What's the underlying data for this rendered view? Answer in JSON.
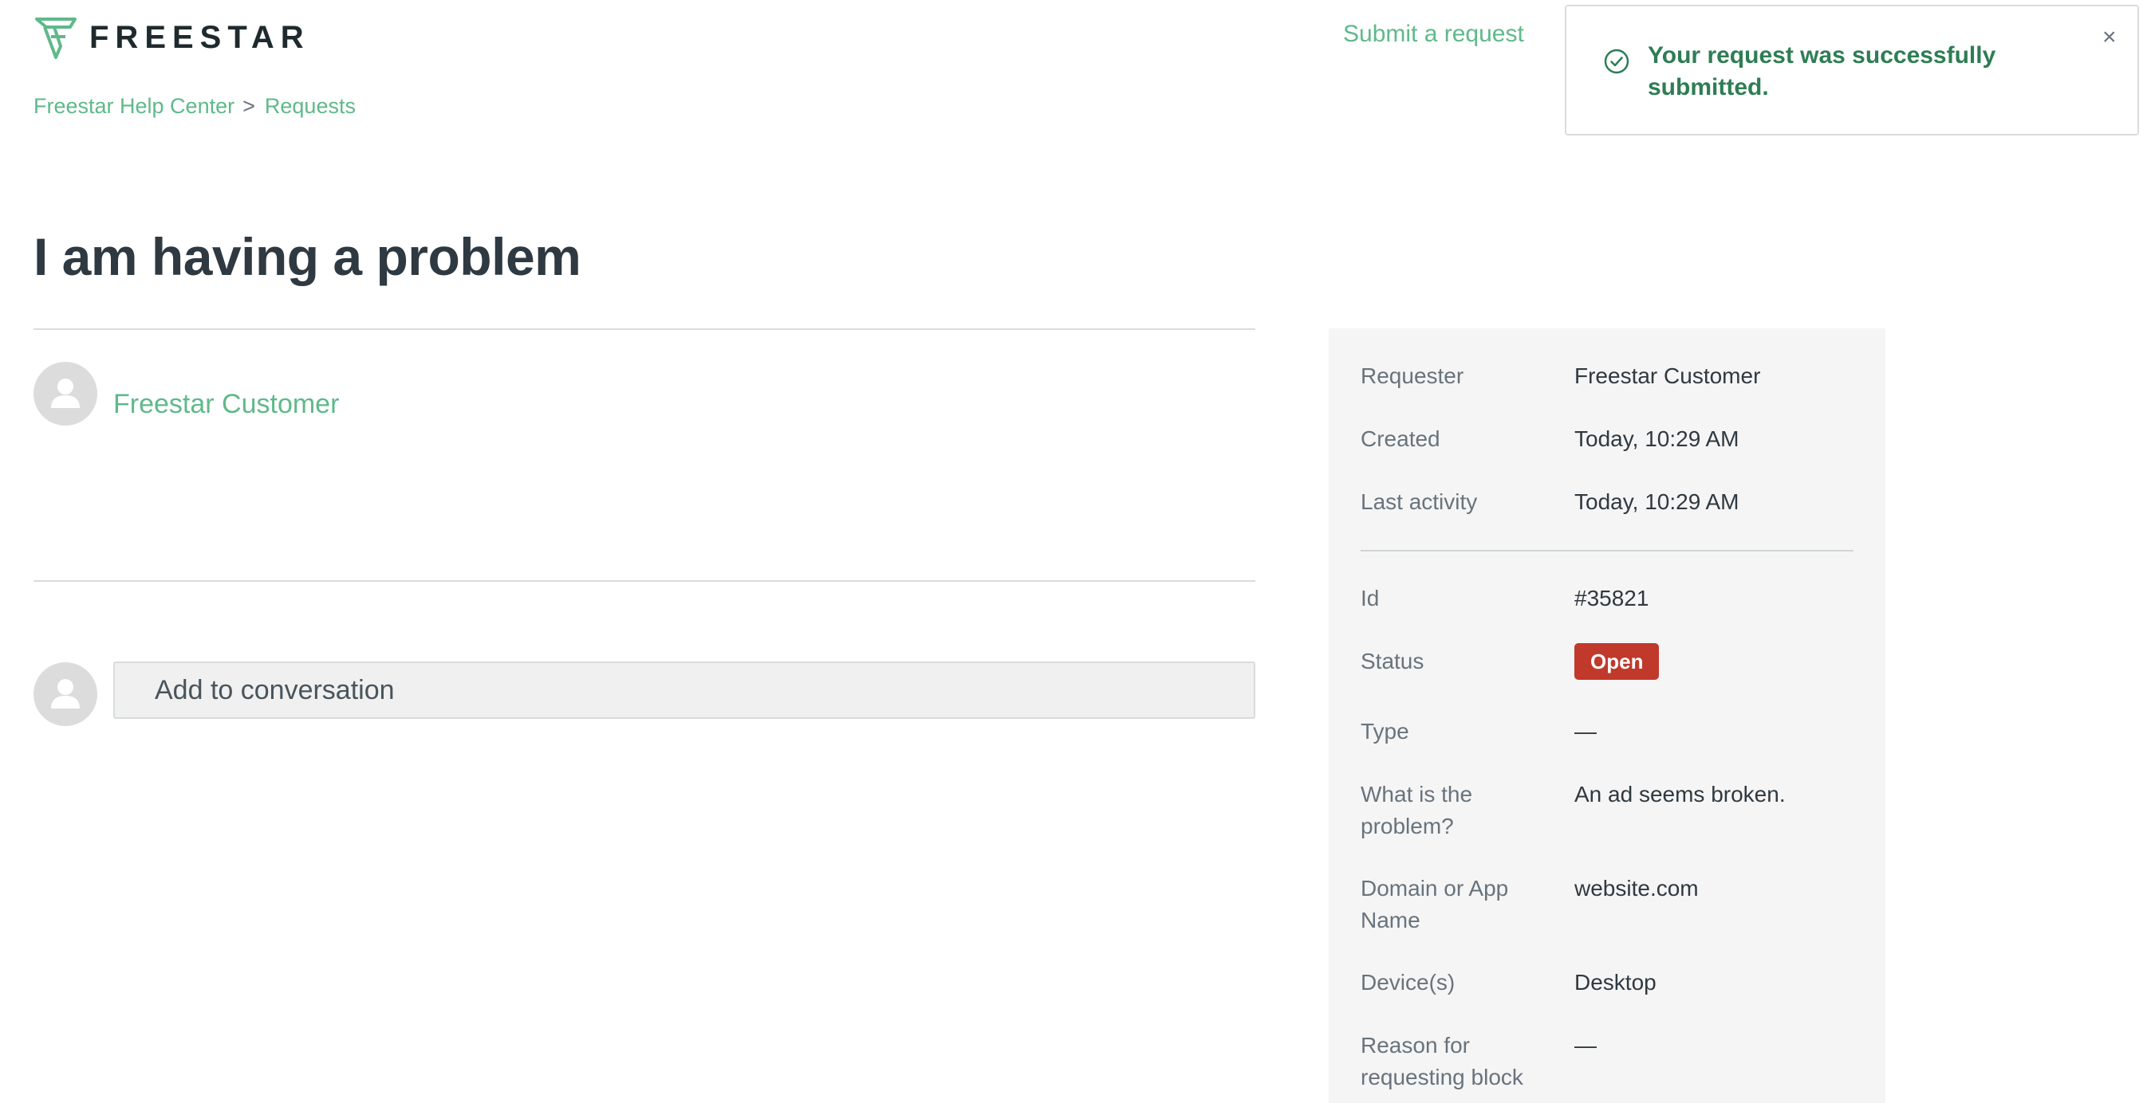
{
  "header": {
    "brand": "FREESTAR",
    "submit_link": "Submit a request"
  },
  "toast": {
    "message": "Your request was successfully submitted.",
    "close": "×"
  },
  "breadcrumb": {
    "items": [
      "Freestar Help Center",
      "Requests"
    ],
    "separator": ">"
  },
  "request": {
    "title": "I am having a problem",
    "author": "Freestar Customer",
    "reply_placeholder": "Add to conversation"
  },
  "details": {
    "requester": {
      "label": "Requester",
      "value": "Freestar Customer"
    },
    "created": {
      "label": "Created",
      "value": "Today, 10:29 AM"
    },
    "last_activity": {
      "label": "Last activity",
      "value": "Today, 10:29 AM"
    },
    "id": {
      "label": "Id",
      "value": "#35821"
    },
    "status": {
      "label": "Status",
      "value": "Open"
    },
    "type": {
      "label": "Type",
      "value": "—"
    },
    "problem": {
      "label": "What is the problem?",
      "value": "An ad seems broken."
    },
    "domain": {
      "label": "Domain or App Name",
      "value": "website.com"
    },
    "devices": {
      "label": "Device(s)",
      "value": "Desktop"
    },
    "block_reason": {
      "label": "Reason for requesting block",
      "value": "—"
    }
  },
  "colors": {
    "accent": "#5fb98a",
    "success": "#2e7d54",
    "status_open": "#c0392b"
  }
}
